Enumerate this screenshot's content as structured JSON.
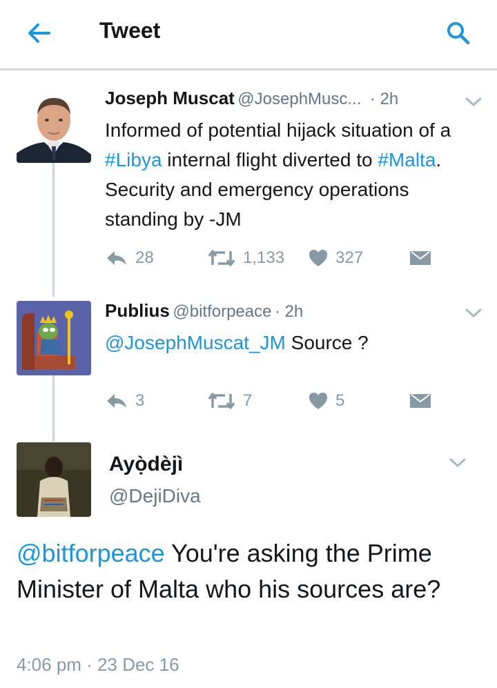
{
  "header": {
    "title": "Tweet",
    "back_icon": "arrow-left-icon",
    "search_icon": "search-icon",
    "accent": "#1b95e0"
  },
  "tweets": [
    {
      "name": "Joseph Muscat",
      "handle": "@JosephMusc...",
      "time": "· 2h",
      "text_parts": [
        "Informed of potential hijack situation of a ",
        "#Libya",
        " internal flight diverted to ",
        "#Malta",
        ". Security and emergency operations standing by -JM"
      ],
      "replies": "28",
      "retweets": "1,133",
      "likes": "327"
    },
    {
      "name": "Publius",
      "handle": "@bitforpeace",
      "time": "· 2h",
      "mention": "@JosephMuscat_JM",
      "text": " Source ?",
      "replies": "3",
      "retweets": "7",
      "likes": "5"
    }
  ],
  "focus_tweet": {
    "name": "Ayọ̀dèjì",
    "handle": "@DejiDiva",
    "mention": "@bitforpeace",
    "text": " You're asking the Prime Minister of Malta who his sources are?",
    "timestamp": "4:06 pm · 23 Dec 16"
  },
  "colors": {
    "link": "#1b95e0",
    "muted": "#8899a6",
    "handle": "#657786",
    "text": "#14171a",
    "divider": "#d6dbdf"
  }
}
